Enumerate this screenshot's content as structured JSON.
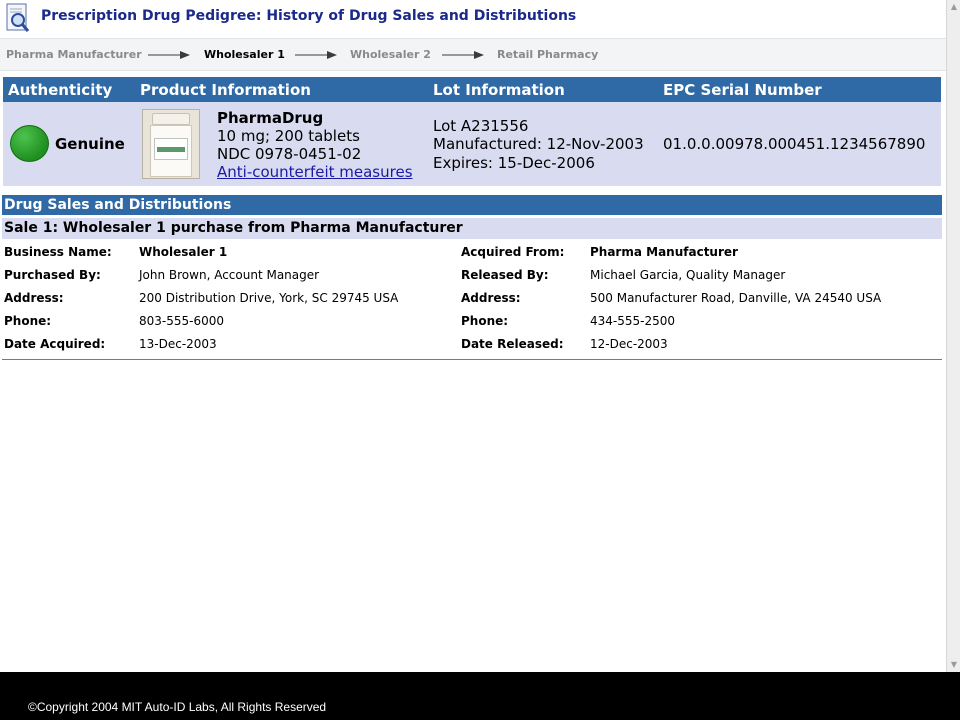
{
  "header": {
    "title": "Prescription Drug Pedigree: History of Drug Sales and Distributions",
    "icon": "magnifier-document-icon"
  },
  "breadcrumb": {
    "steps": [
      "Pharma Manufacturer",
      "Wholesaler 1",
      "Wholesaler 2",
      "Retail Pharmacy"
    ],
    "active": "Wholesaler 1"
  },
  "summary": {
    "headers": {
      "authenticity": "Authenticity",
      "product": "Product Information",
      "lot": "Lot Information",
      "epc": "EPC Serial Number"
    },
    "authenticity_status": "Genuine",
    "status_color": "#2ea02e",
    "product": {
      "name": "PharmaDrug",
      "dose": "10 mg; 200 tablets",
      "ndc": "NDC 0978-0451-02",
      "link": "Anti-counterfeit measures"
    },
    "lot": {
      "number": "Lot A231556",
      "manufactured": "Manufactured: 12-Nov-2003",
      "expires": "Expires: 15-Dec-2006"
    },
    "epc_serial": "01.0.0.00978.000451.1234567890"
  },
  "sales": {
    "section_title": "Drug Sales and Distributions",
    "sale_title": "Sale 1: Wholesaler 1 purchase from Pharma Manufacturer",
    "left": {
      "labels": [
        "Business Name:",
        "Purchased By:",
        "Address:",
        "Phone:",
        "Date Acquired:"
      ],
      "values": [
        "Wholesaler 1",
        "John Brown, Account Manager",
        "200 Distribution Drive, York, SC 29745 USA",
        "803-555-6000",
        "13-Dec-2003"
      ]
    },
    "right": {
      "labels": [
        "Acquired From:",
        "Released By:",
        "Address:",
        "Phone:",
        "Date Released:"
      ],
      "values": [
        "Pharma Manufacturer",
        "Michael Garcia, Quality Manager",
        "500 Manufacturer Road, Danville, VA 24540 USA",
        "434-555-2500",
        "12-Dec-2003"
      ]
    }
  },
  "footer": {
    "copyright": "©Copyright 2004 MIT Auto-ID Labs, All Rights Reserved"
  },
  "colors": {
    "title": "#1b2a8a",
    "header_bar": "#2f6aa6",
    "row_band": "#d9dcf0",
    "link": "#1a1aa6"
  }
}
